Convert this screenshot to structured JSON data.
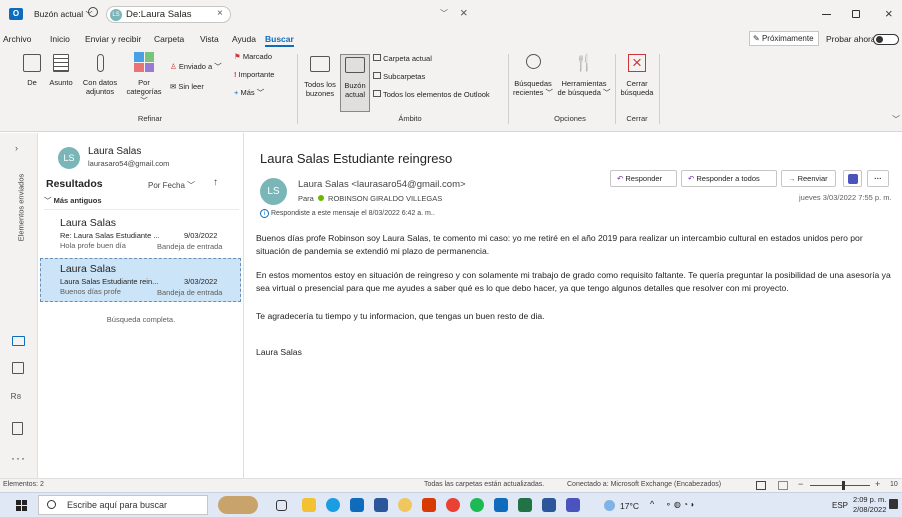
{
  "titlebar": {
    "scope_label": "Buzón actual",
    "search_chip": "De:Laura Salas",
    "chip_initials": "LS"
  },
  "menu": {
    "items": [
      "Archivo",
      "Inicio",
      "Enviar y recibir",
      "Carpeta",
      "Vista",
      "Ayuda",
      "Buscar"
    ],
    "proximamente": "Próximamente",
    "probar_ahora": "Probar ahora"
  },
  "ribbon": {
    "refinar": {
      "group_label": "Refinar",
      "de": "De",
      "asunto": "Asunto",
      "con_datos": "Con datos",
      "adjuntos": "adjuntos",
      "por": "Por",
      "categorias": "categorías",
      "enviado_a": "Enviado a",
      "sin_leer": "Sin leer",
      "marcado": "Marcado",
      "importante": "Importante",
      "mas": "Más"
    },
    "ambito": {
      "group_label": "Ámbito",
      "todos_los": "Todos los",
      "buzones": "buzones",
      "buzon": "Buzón",
      "actual": "actual",
      "carpeta_actual": "Carpeta actual",
      "subcarpetas": "Subcarpetas",
      "todos_elementos": "Todos los elementos de Outlook"
    },
    "opciones": {
      "group_label": "Opciones",
      "busquedas": "Búsquedas",
      "recientes": "recientes",
      "herramientas": "Herramientas",
      "de_busqueda": "de búsqueda"
    },
    "cerrar": {
      "group_label": "Cerrar",
      "cerrar": "Cerrar",
      "busqueda": "búsqueda"
    }
  },
  "leftrail": {
    "folder_label": "Elementos enviados"
  },
  "list": {
    "contact_name": "Laura Salas",
    "contact_email": "laurasaro54@gmail.com",
    "contact_initials": "LS",
    "results_label": "Resultados",
    "sort_label": "Por Fecha",
    "group_label": "Más antiguos",
    "items": [
      {
        "sender": "Laura Salas",
        "subject": "Re: Laura Salas Estudiante ...",
        "date": "9/03/2022",
        "preview": "Hola profe buen día",
        "folder": "Bandeja de entrada"
      },
      {
        "sender": "Laura Salas",
        "subject": "Laura Salas Estudiante rein...",
        "date": "3/03/2022",
        "preview": "Buenos días profe",
        "folder": "Bandeja de entrada"
      }
    ],
    "complete_label": "Búsqueda completa."
  },
  "message": {
    "subject": "Laura Salas Estudiante reingreso",
    "from": "Laura Salas <laurasaro54@gmail.com>",
    "to_prefix": "Para",
    "to": "ROBINSON GIRALDO VILLEGAS",
    "initials": "LS",
    "replied_note": "Respondiste a este mensaje el 8/03/2022 6:42 a. m..",
    "date": "jueves 3/03/2022 7:55 p. m.",
    "reply": "Responder",
    "reply_all": "Responder a todos",
    "forward": "Reenviar",
    "more": "···",
    "body": [
      "Buenos días profe Robinson soy Laura Salas, te comento mi caso: yo me retiré en el año 2019 para realizar un intercambio cultural en estados unidos pero por situación de pandemia se extendió mi plazo de permanencia.",
      "En estos momentos estoy en situación de reingreso y con solamente mi trabajo de grado como requisito faltante. Te quería preguntar la posibilidad de una asesoría ya sea virtual o presencial para que me ayudes a saber qué es lo que debo hacer, ya que tengo algunos detalles que resolver con mi proyecto.",
      "Te agradecería tu tiempo y tu informacion, que tengas un buen resto de dia.",
      "Laura Salas"
    ]
  },
  "status": {
    "items_count": "Elementos: 2",
    "all_updated": "Todas las carpetas están actualizadas.",
    "connected": "Conectado a: Microsoft Exchange (Encabezados)",
    "zoom_minus": "−",
    "zoom_plus": "+",
    "zoom_value": "10"
  },
  "taskbar": {
    "search_placeholder": "Escribe aquí para buscar",
    "temperature": "17°C",
    "language": "ESP",
    "time": "2:09 p. m.",
    "date": "2/08/2022"
  },
  "colors": {
    "accent": "#0f6cbd",
    "selected_item": "#cce4f7",
    "avatar_teal": "#7ab5b8",
    "status_bg": "#f3f2f1"
  }
}
